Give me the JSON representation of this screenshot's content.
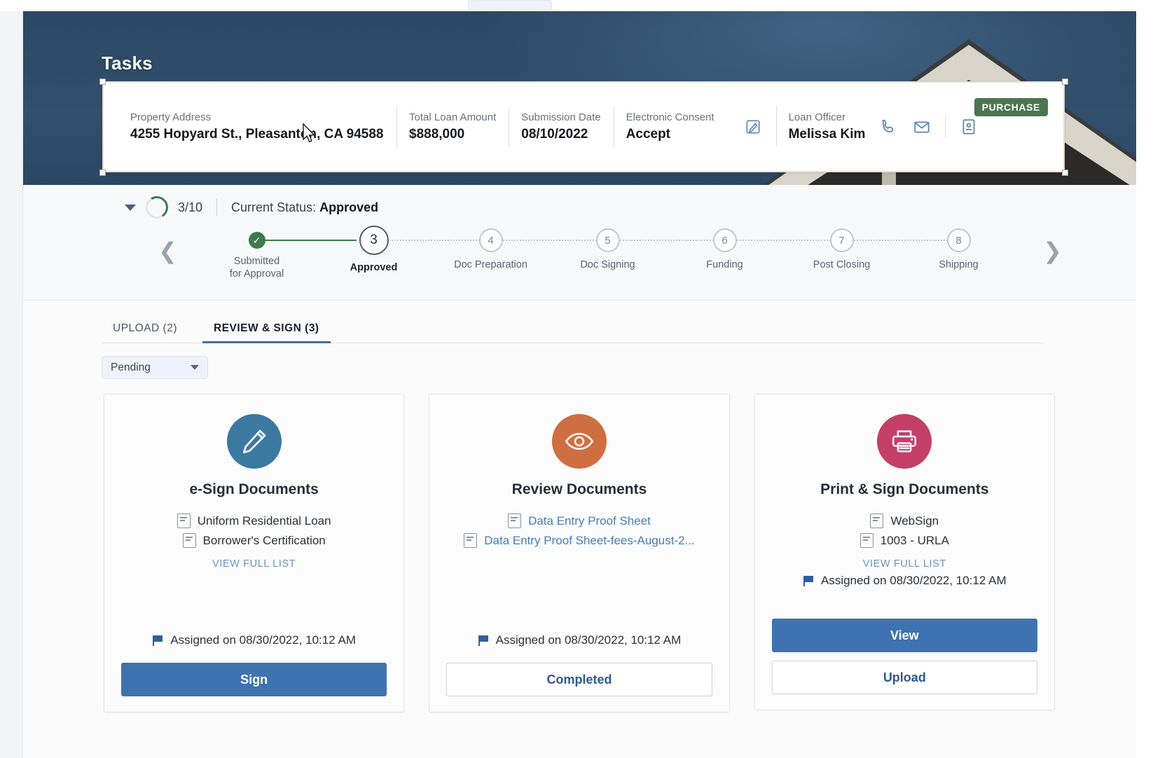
{
  "hero": {
    "title": "Tasks"
  },
  "summary": {
    "badge": "PURCHASE",
    "fields": [
      {
        "label": "Property Address",
        "value": "4255 Hopyard St., Pleasanton, CA 94588"
      },
      {
        "label": "Total Loan Amount",
        "value": "$888,000"
      },
      {
        "label": "Submission Date",
        "value": "08/10/2022"
      },
      {
        "label": "Electronic Consent",
        "value": "Accept"
      },
      {
        "label": "Loan Officer",
        "value": "Melissa Kim"
      }
    ],
    "icons": {
      "esign": "signature-icon",
      "phone": "phone-icon",
      "email": "envelope-icon",
      "contact_card": "contact-card-icon"
    }
  },
  "status": {
    "progress_ratio": "3/10",
    "current_status_label": "Current Status:",
    "current_status_value": "Approved",
    "prev_arrow": "chevron-left-icon",
    "next_arrow": "chevron-right-icon",
    "steps": [
      {
        "num": "✓",
        "label": "Submitted\nfor Approval",
        "state": "done"
      },
      {
        "num": "3",
        "label": "Approved",
        "state": "current"
      },
      {
        "num": "4",
        "label": "Doc Preparation",
        "state": "upcoming"
      },
      {
        "num": "5",
        "label": "Doc Signing",
        "state": "upcoming"
      },
      {
        "num": "6",
        "label": "Funding",
        "state": "upcoming"
      },
      {
        "num": "7",
        "label": "Post Closing",
        "state": "upcoming"
      },
      {
        "num": "8",
        "label": "Shipping",
        "state": "upcoming"
      }
    ]
  },
  "tabs": [
    {
      "label": "UPLOAD (2)",
      "active": false
    },
    {
      "label": "REVIEW & SIGN (3)",
      "active": true
    }
  ],
  "filter": {
    "selected": "Pending",
    "chevron": "chevron-down-icon"
  },
  "cards": [
    {
      "icon": "pencil-icon",
      "icon_color": "#3c79a0",
      "title": "e-Sign Documents",
      "documents": [
        {
          "name": "Uniform Residential Loan",
          "is_link": false
        },
        {
          "name": "Borrower's Certification",
          "is_link": false
        }
      ],
      "view_full_list": "VIEW FULL LIST",
      "assigned": "Assigned on 08/30/2022, 10:12 AM",
      "buttons": [
        {
          "label": "Sign",
          "style": "primary"
        }
      ]
    },
    {
      "icon": "eye-icon",
      "icon_color": "#cf6e41",
      "title": "Review Documents",
      "documents": [
        {
          "name": "Data Entry Proof Sheet",
          "is_link": true
        },
        {
          "name": "Data Entry Proof Sheet-fees-August-2...",
          "is_link": true
        }
      ],
      "view_full_list": "",
      "assigned": "Assigned on 08/30/2022, 10:12 AM",
      "buttons": [
        {
          "label": "Completed",
          "style": "outline"
        }
      ]
    },
    {
      "icon": "printer-icon",
      "icon_color": "#c33f6a",
      "title": "Print & Sign Documents",
      "documents": [
        {
          "name": "WebSign",
          "is_link": false
        },
        {
          "name": "1003 - URLA",
          "is_link": false
        }
      ],
      "view_full_list": "VIEW FULL LIST",
      "assigned": "Assigned on 08/30/2022, 10:12 AM",
      "buttons": [
        {
          "label": "View",
          "style": "primary"
        },
        {
          "label": "Upload",
          "style": "outline"
        }
      ]
    }
  ],
  "colors": {
    "hero_bg": "#2f4d69",
    "badge_green": "#4b7550",
    "tab_accent": "#3d6fa8",
    "primary_button": "#3f72b0",
    "step_done": "#3f7a4a"
  }
}
